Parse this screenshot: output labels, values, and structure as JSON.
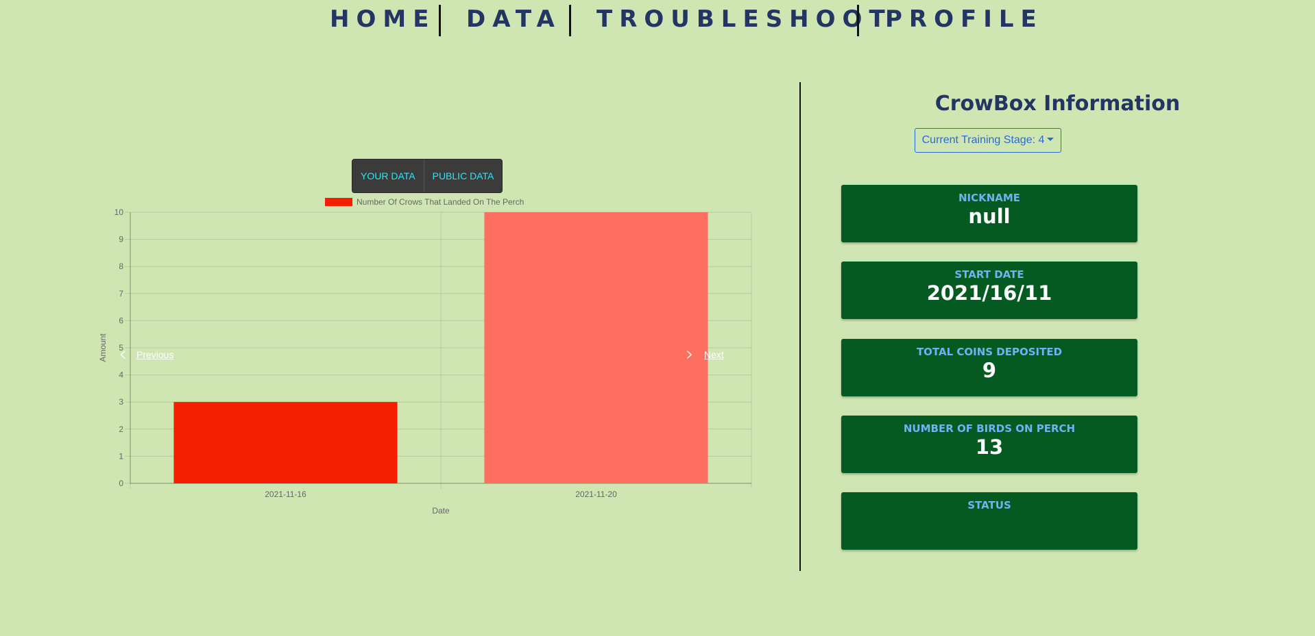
{
  "nav": {
    "items": [
      {
        "label": "HOME"
      },
      {
        "label": "DATA"
      },
      {
        "label": "TROUBLESHOOT"
      },
      {
        "label": "PROFILE"
      }
    ]
  },
  "chart_tabs": {
    "your_data": "YOUR DATA",
    "public_data": "PUBLIC DATA"
  },
  "carousel": {
    "previous": "Previous",
    "next": "Next"
  },
  "chart_data": {
    "type": "bar",
    "categories": [
      "2021-11-16",
      "2021-11-20"
    ],
    "series": [
      {
        "name": "Number Of Crows That Landed On The Perch",
        "values": [
          3,
          10
        ]
      }
    ],
    "bar_colors": [
      "#f41e00",
      "#ff7060"
    ],
    "xlabel": "Date",
    "ylabel": "Amount",
    "ylim": [
      0,
      10
    ],
    "yticks": [
      0,
      1,
      2,
      3,
      4,
      5,
      6,
      7,
      8,
      9,
      10
    ],
    "grid": true,
    "legend": "top"
  },
  "info": {
    "title": "CrowBox Information",
    "stage_button": "Current Training Stage: 4",
    "cards": [
      {
        "label": "NICKNAME",
        "value": "null"
      },
      {
        "label": "START DATE",
        "value": "2021/16/11"
      },
      {
        "label": "TOTAL COINS DEPOSITED",
        "value": "9"
      },
      {
        "label": "NUMBER OF BIRDS ON PERCH",
        "value": "13"
      },
      {
        "label": "STATUS",
        "value": ""
      }
    ]
  },
  "colors": {
    "background": "#cfe6b3",
    "nav_text": "#233563",
    "card_bg": "#055a22",
    "card_label": "#6fb3f2",
    "stage_button": "#2a6bd1"
  }
}
